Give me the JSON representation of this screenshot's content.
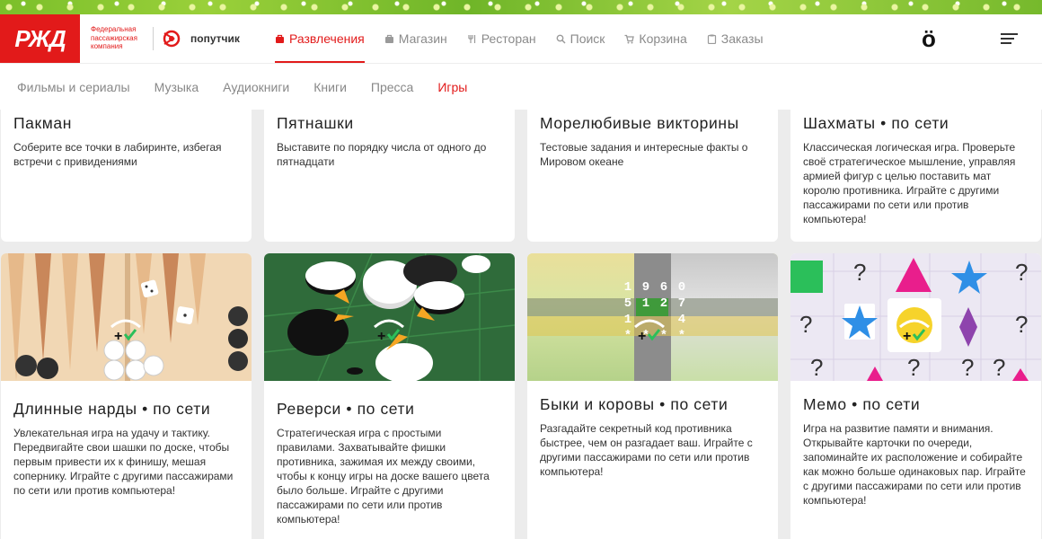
{
  "brand": {
    "logo_text": "РЖД",
    "company": "Федеральная пассажирская компания",
    "service": "попутчик",
    "right_logo": "ö",
    "colors": {
      "accent": "#e21a1a"
    }
  },
  "main_nav": [
    {
      "label": "Развлечения",
      "icon": "bag-icon"
    },
    {
      "label": "Магазин",
      "icon": "shop-icon"
    },
    {
      "label": "Ресторан",
      "icon": "fork-icon"
    },
    {
      "label": "Поиск",
      "icon": "search-icon"
    },
    {
      "label": "Корзина",
      "icon": "cart-icon"
    },
    {
      "label": "Заказы",
      "icon": "clipboard-icon"
    }
  ],
  "sub_nav": [
    {
      "label": "Фильмы и сериалы"
    },
    {
      "label": "Музыка"
    },
    {
      "label": "Аудиокниги"
    },
    {
      "label": "Книги"
    },
    {
      "label": "Пресса"
    },
    {
      "label": "Игры"
    }
  ],
  "games_row1": [
    {
      "title": "Пакман",
      "desc": "Соберите все точки в лабиринте, избегая встречи с привидениями"
    },
    {
      "title": "Пятнашки",
      "desc": "Выставите по порядку числа от одного до пятнадцати"
    },
    {
      "title": "Морелюбивые викторины",
      "desc": "Тестовые задания и интересные факты о Мировом океане"
    },
    {
      "title": "Шахматы • по сети",
      "desc": "Классическая логическая игра. Проверьте своё стратегическое мышление, управляя армией фигур с целью поставить мат королю противника. Играйте с другими пассажирами по сети или против компьютера!"
    }
  ],
  "games_row2": [
    {
      "title": "Длинные нарды • по сети",
      "desc": "Увлекательная игра на удачу и тактику. Передвигайте свои шашки по доске, чтобы первым привести их к финишу, мешая сопернику. Играйте с другими пассажирами по сети или против компьютера!"
    },
    {
      "title": "Реверси • по сети",
      "desc": "Стратегическая игра с простыми правилами. Захватывайте фишки противника, зажимая их между своими, чтобы к концу игры на доске вашего цвета было больше. Играйте с другими пассажирами по сети или против компьютера!"
    },
    {
      "title": "Быки и коровы • по сети",
      "desc": "Разгадайте секретный код противника быстрее, чем он разгадает ваш. Играйте с другими пассажирами по сети или против компьютера!"
    },
    {
      "title": "Мемо • по сети",
      "desc": "Игра на развитие памяти и внимания. Открывайте карточки по очереди, запоминайте их расположение и собирайте как можно больше одинаковых пар. Играйте с другими пассажирами по сети или против компьютера!"
    }
  ],
  "bulls_digits": [
    [
      "1",
      "9",
      "6",
      "0"
    ],
    [
      "5",
      "1",
      "2",
      "7"
    ],
    [
      "1",
      "",
      "",
      "4"
    ],
    [
      "*",
      "*",
      "*",
      "*"
    ]
  ],
  "memo_tiles": [
    "?",
    "?",
    "?",
    "?",
    "?",
    "?",
    "?",
    "?"
  ]
}
